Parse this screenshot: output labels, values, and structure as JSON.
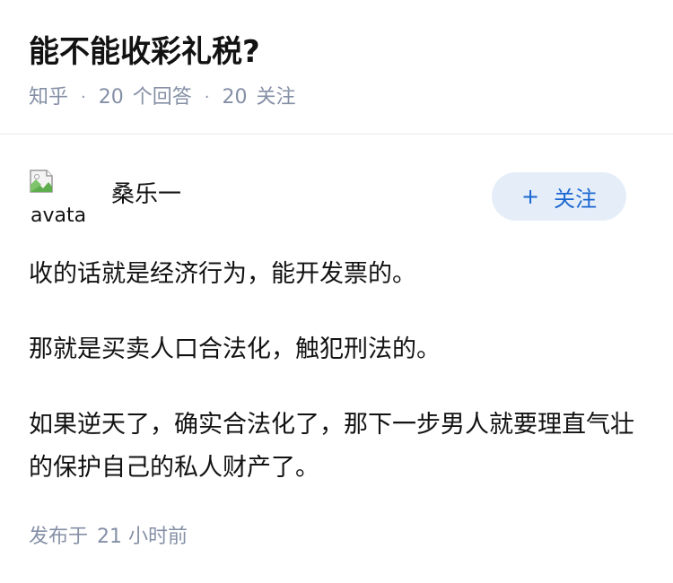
{
  "question": {
    "title": "能不能收彩礼税?",
    "source": "知乎",
    "answer_count": "20",
    "answer_unit": "个回答",
    "follower_count": "20",
    "follower_unit": "关注",
    "separator": "·"
  },
  "author": {
    "name": "桑乐一",
    "avatar_alt": "avatar",
    "avatar_icon": "broken-image-icon"
  },
  "follow_button": {
    "plus": "+",
    "label": "关注"
  },
  "answer": {
    "paragraphs": [
      "收的话就是经济行为，能开发票的。",
      "那就是买卖人口合法化，触犯刑法的。",
      "如果逆天了，确实合法化了，那下一步男人就要理直气壮的保护自己的私人财产了。"
    ]
  },
  "publish": {
    "prefix": "发布于",
    "time": "21 小时前"
  },
  "colors": {
    "title": "#121212",
    "meta": "#8590a6",
    "follow_bg": "#e5eef8",
    "follow_text": "#1a66d1",
    "divider": "#ebebeb"
  }
}
